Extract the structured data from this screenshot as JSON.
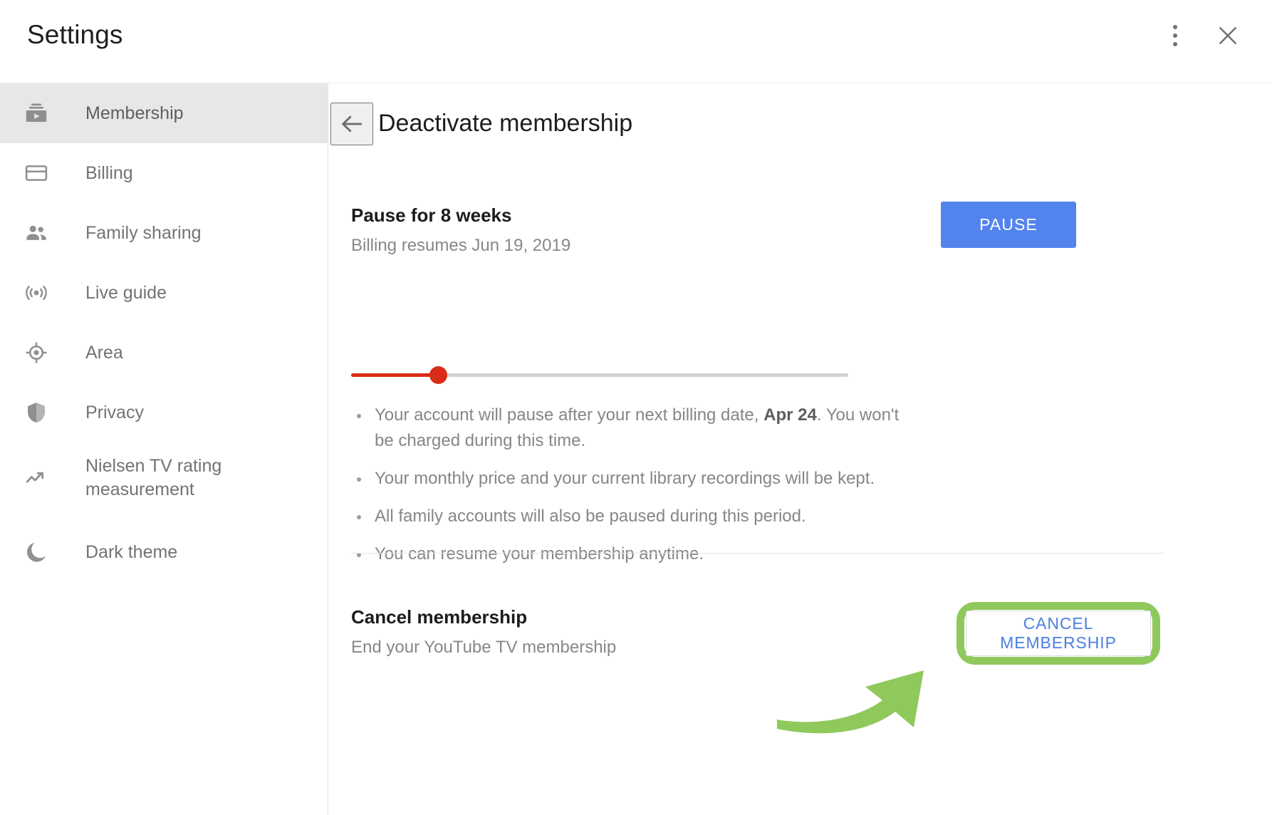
{
  "window": {
    "title": "Settings",
    "more_options_icon": "kebab-menu-icon",
    "close_icon": "close-icon"
  },
  "sidebar": {
    "items": [
      {
        "label": "Membership",
        "icon": "subscriptions-icon",
        "selected": true
      },
      {
        "label": "Billing",
        "icon": "credit-card-icon",
        "selected": false
      },
      {
        "label": "Family sharing",
        "icon": "people-icon",
        "selected": false
      },
      {
        "label": "Live guide",
        "icon": "live-broadcast-icon",
        "selected": false
      },
      {
        "label": "Area",
        "icon": "location-target-icon",
        "selected": false
      },
      {
        "label": "Privacy",
        "icon": "shield-icon",
        "selected": false
      },
      {
        "label": "Nielsen TV rating measurement",
        "icon": "trending-up-icon",
        "selected": false
      },
      {
        "label": "Dark theme",
        "icon": "moon-icon",
        "selected": false
      }
    ]
  },
  "main": {
    "back_icon": "back-arrow-icon",
    "page_title": "Deactivate membership",
    "pause_section": {
      "title": "Pause for 8 weeks",
      "subtitle": "Billing resumes Jun 19, 2019",
      "button_label": "PAUSE",
      "button_color": "#5384ee",
      "slider": {
        "value_percent": 18,
        "fill_color": "#d92b16",
        "track_color": "#d2d2d2"
      },
      "bullets": [
        {
          "prefix": "Your account will pause after your next billing date, ",
          "emphasis": "Apr 24",
          "suffix": ". You won't be charged during this time."
        },
        {
          "prefix": "Your monthly price and your current library recordings will be kept.",
          "emphasis": "",
          "suffix": ""
        },
        {
          "prefix": "All family accounts will also be paused during this period.",
          "emphasis": "",
          "suffix": ""
        },
        {
          "prefix": "You can resume your membership anytime.",
          "emphasis": "",
          "suffix": ""
        }
      ]
    },
    "cancel_section": {
      "title": "Cancel membership",
      "subtitle": "End your YouTube TV membership",
      "button_label": "CANCEL MEMBERSHIP",
      "button_text_color": "#4a7fe0",
      "highlight_color": "#8fc95c",
      "annotation_icon": "green-curved-arrow-icon"
    }
  }
}
